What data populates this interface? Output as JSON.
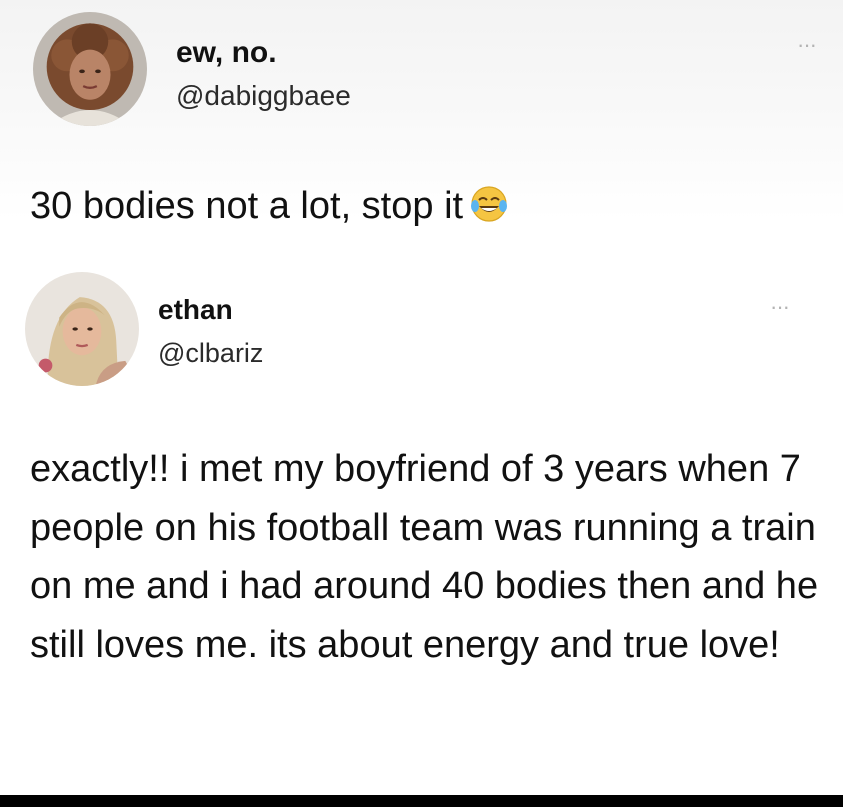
{
  "tweet": {
    "display_name": "ew, no.",
    "handle": "@dabiggbaee",
    "more_label": "···",
    "text": "30 bodies not a lot, stop it",
    "emoji_icon": "face-with-tears-of-joy-icon",
    "avatar_icon": "profile-photo-icon"
  },
  "reply": {
    "display_name": "ethan",
    "handle": "@clbariz",
    "more_label": "···",
    "text": "exactly!! i met my boyfriend of 3 years when 7 people on his football team was running a train on me and i had around 40 bodies then and he still loves me. its about energy and true love!",
    "avatar_icon": "profile-photo-icon"
  },
  "colors": {
    "text": "#111111",
    "muted": "#b3b3b3",
    "background": "#ffffff"
  }
}
